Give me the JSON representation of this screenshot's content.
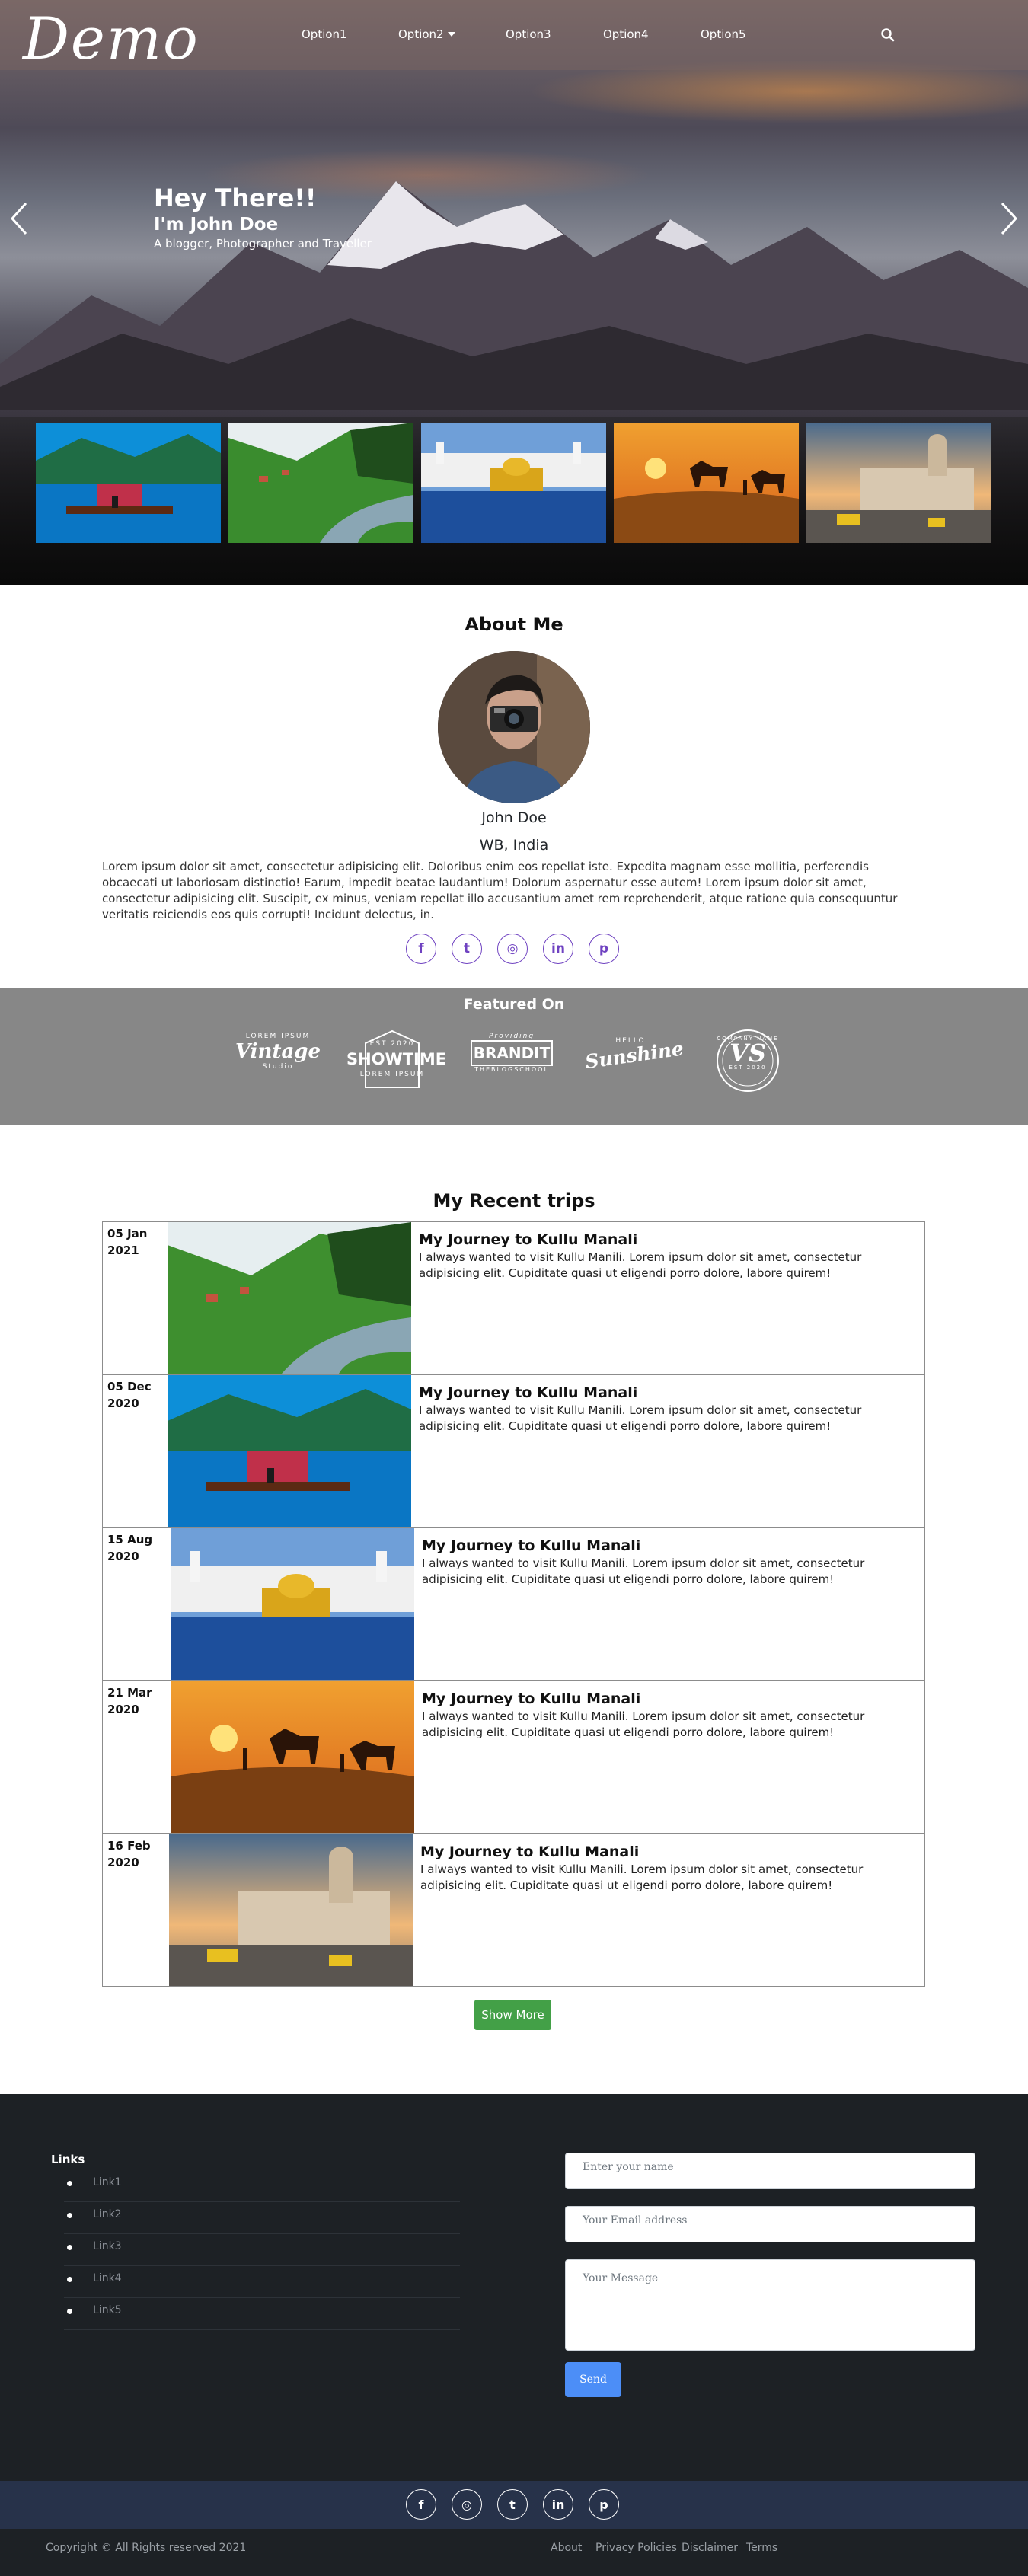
{
  "nav": {
    "logo": "Demo",
    "items": [
      "Option1",
      "Option2",
      "Option3",
      "Option4",
      "Option5"
    ]
  },
  "hero": {
    "heading": "Hey There!!",
    "subheading": "I'm John Doe",
    "tagline": "A blogger, Photographer and Traveller"
  },
  "about": {
    "title": "About Me",
    "name": "John Doe",
    "location": "WB, India",
    "bio": "Lorem ipsum dolor sit amet, consectetur adipisicing elit. Doloribus enim eos repellat iste. Expedita magnam esse mollitia, perferendis obcaecati ut laboriosam distinctio! Earum, impedit beatae laudantium! Dolorum aspernatur esse autem! Lorem ipsum dolor sit amet, consectetur adipisicing elit. Suscipit, ex minus, veniam repellat illo accusantium amet rem reprehenderit, atque ratione quia consequuntur veritatis reiciendis eos quis corrupti! Incidunt delectus, in.",
    "social": [
      "f",
      "t",
      "◎",
      "in",
      "p"
    ]
  },
  "featured": {
    "title": "Featured On",
    "brands": [
      {
        "top": "LOREM IPSUM",
        "big": "Vintage",
        "bottom": "Studio"
      },
      {
        "top": "EST 2020",
        "big": "SHOWTIME",
        "bottom": "LOREM IPSUM"
      },
      {
        "top": "Providing",
        "big": "BRANDIT",
        "bottom": "THEBLOGSCHOOL"
      },
      {
        "top": "HELLO",
        "big": "Sunshine",
        "bottom": ""
      },
      {
        "top": "COMPANY NAME",
        "big": "VS",
        "bottom": "EST 2020"
      }
    ]
  },
  "trips": {
    "title": "My Recent trips",
    "items": [
      {
        "date": "05 Jan 2021",
        "title": "My Journey to Kullu Manali",
        "text": "I always wanted to visit Kullu Manili. Lorem ipsum dolor sit amet, consectetur adipisicing elit. Cupiditate quasi ut eligendi porro dolore, labore quirem!"
      },
      {
        "date": "05 Dec 2020",
        "title": "My Journey to Kullu Manali",
        "text": "I always wanted to visit Kullu Manili. Lorem ipsum dolor sit amet, consectetur adipisicing elit. Cupiditate quasi ut eligendi porro dolore, labore quirem!"
      },
      {
        "date": "15 Aug 2020",
        "title": "My Journey to Kullu Manali",
        "text": "I always wanted to visit Kullu Manili. Lorem ipsum dolor sit amet, consectetur adipisicing elit. Cupiditate quasi ut eligendi porro dolore, labore quirem!"
      },
      {
        "date": "21 Mar 2020",
        "title": "My Journey to Kullu Manali",
        "text": "I always wanted to visit Kullu Manili. Lorem ipsum dolor sit amet, consectetur adipisicing elit. Cupiditate quasi ut eligendi porro dolore, labore quirem!"
      },
      {
        "date": "16 Feb 2020",
        "title": "My Journey to Kullu Manali",
        "text": "I always wanted to visit Kullu Manili. Lorem ipsum dolor sit amet, consectetur adipisicing elit. Cupiditate quasi ut eligendi porro dolore, labore quirem!"
      }
    ],
    "show_more": "Show More"
  },
  "footer": {
    "links_title": "Links",
    "links": [
      "Link1",
      "Link2",
      "Link3",
      "Link4",
      "Link5"
    ],
    "form": {
      "name_placeholder": "Enter your name",
      "email_placeholder": "Your Email address",
      "message_placeholder": "Your Message",
      "send": "Send"
    },
    "social": [
      "f",
      "◎",
      "t",
      "in",
      "p"
    ],
    "copyright": "Copyright © All Rights reserved 2021",
    "bottom_links": [
      "About",
      "Privacy Policies",
      "Disclaimer",
      "Terms"
    ]
  },
  "colors": {
    "accent_purple": "#6f42c1",
    "show_more_green": "#43a047",
    "send_blue": "#4c8ef7",
    "footer_bg": "#1d2125",
    "social_bar_bg": "#27324a"
  }
}
